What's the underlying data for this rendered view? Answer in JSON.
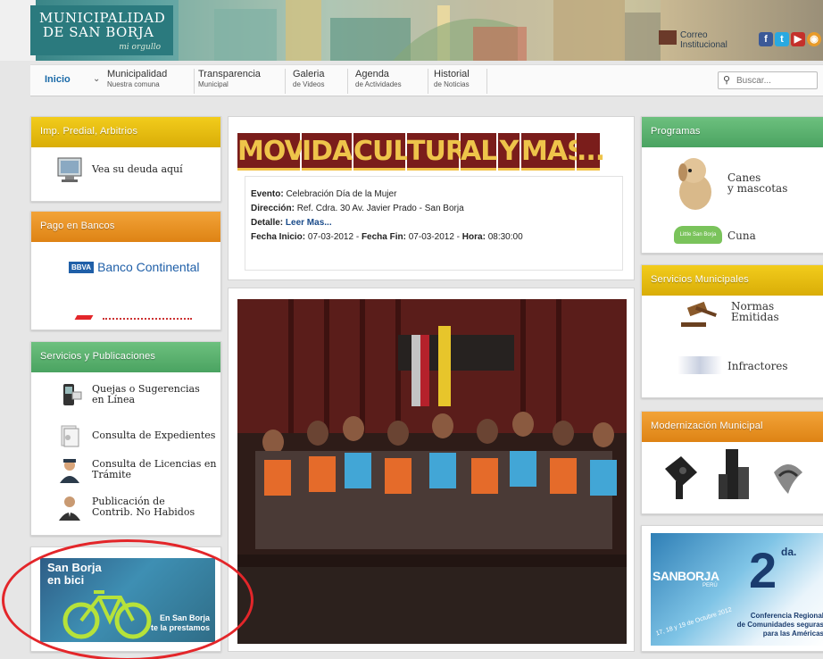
{
  "header": {
    "logo_line1": "MUNICIPALIDAD",
    "logo_line2": "DE SAN BORJA",
    "logo_tagline": "mi orgullo",
    "correo_line1": "Correo",
    "correo_line2": "Institucional"
  },
  "nav": {
    "inicio": "Inicio",
    "items": [
      {
        "t1": "Municipalidad",
        "t2": "Nuestra comuna"
      },
      {
        "t1": "Transparencia",
        "t2": "Municipal"
      },
      {
        "t1": "Galeria",
        "t2": "de Videos"
      },
      {
        "t1": "Agenda",
        "t2": "de Actividades"
      },
      {
        "t1": "Historial",
        "t2": "de Noticias"
      }
    ],
    "search_placeholder": "Buscar..."
  },
  "left": {
    "predial": {
      "title": "Imp. Predial, Arbitrios",
      "link": "Vea su deuda aquí"
    },
    "bancos": {
      "title": "Pago en Bancos",
      "bank1_badge": "BBVA",
      "bank1": "Banco Continental"
    },
    "servicios": {
      "title": "Servicios y Publicaciones",
      "items": [
        {
          "line1": "Quejas o Sugerencias",
          "line2": "en Línea"
        },
        {
          "line1": "Consulta de Expedientes",
          "line2": ""
        },
        {
          "line1": "Consulta de Licencias en",
          "line2": "Trámite"
        },
        {
          "line1": "Publicación de",
          "line2": "Contrib. No Habidos"
        }
      ]
    },
    "bici": {
      "line1": "San Borja",
      "line2": "en bici",
      "line3": "En San Borja",
      "line4": "te la prestamos"
    }
  },
  "center": {
    "banner_words": [
      "MOV",
      "IDA",
      "CUL",
      "TUR",
      "AL",
      "Y",
      "MAS",
      "..."
    ],
    "evento_label": "Evento:",
    "evento": "Celebración Día de la Mujer",
    "direccion_label": "Dirección:",
    "direccion": "Ref. Cdra. 30 Av. Javier Prado - San Borja",
    "detalle_label": "Detalle:",
    "detalle_link": "Leer Mas...",
    "fecha_inicio_label": "Fecha Inicio:",
    "fecha_inicio": "07-03-2012",
    "fecha_fin_label": "Fecha Fin:",
    "fecha_fin": "07-03-2012",
    "hora_label": "Hora:",
    "hora": "08:30:00"
  },
  "right": {
    "programas": {
      "title": "Programas",
      "item1_l1": "Canes",
      "item1_l2": "y mascotas",
      "item2": "Cuna",
      "item2_badge": "Little San Borja"
    },
    "servicios_mun": {
      "title": "Servicios Municipales",
      "item1_l1": "Normas",
      "item1_l2": "Emitidas",
      "item2": "Infractores"
    },
    "modernizacion": {
      "title": "Modernización Municipal"
    },
    "conferencia": {
      "brand": "SANBORJA",
      "brand_sub": "PERÚ",
      "dates": "17, 18 y 19 de Octubre 2012",
      "num": "2",
      "sup": "da.",
      "l1": "Conferencia Regional",
      "l2": "de Comunidades seguras",
      "l3": "para las Américas"
    }
  },
  "colors": {
    "yellow": "#e5bb10",
    "orange": "#e8911f",
    "green": "#5db36f",
    "link": "#1a6aa8",
    "highlight": "#e3262a"
  }
}
